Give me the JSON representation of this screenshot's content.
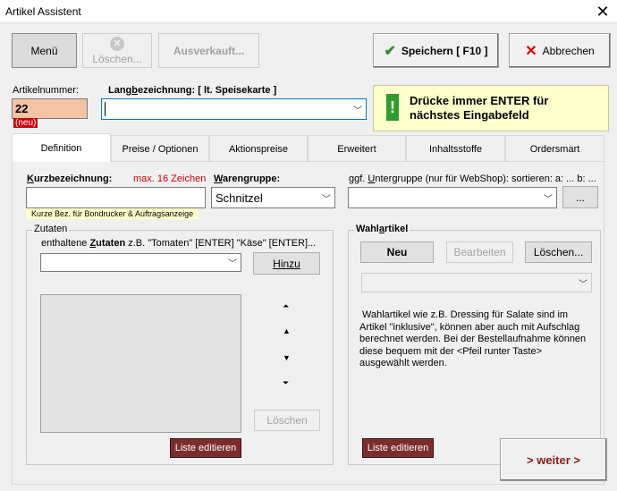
{
  "window": {
    "title": "Artikel Assistent",
    "close": "✕"
  },
  "toolbar": {
    "menu": "Menü",
    "delete": "Löschen...",
    "soldout": "Ausverkauft...",
    "save": "Speichern [ F10 ]",
    "cancel": "Abbrechen"
  },
  "header": {
    "artnr_label": "Artikelnummer:",
    "artnr_value": "22",
    "artnr_new": "(neu)",
    "lang_label_pre": "Lang",
    "lang_label_u": "b",
    "lang_label_post": "ezeichnung:  [ lt. Speisekarte ]",
    "lang_value": "",
    "info": "Drücke immer ENTER für nächstes Eingabefeld",
    "info_icon": "!"
  },
  "tabs": [
    "Definition",
    "Preise / Optionen",
    "Aktionspreise",
    "Erweitert",
    "Inhaltsstoffe",
    "Ordersmart"
  ],
  "definition": {
    "kurz_label_u": "K",
    "kurz_label_post": "urzbezeichnung:",
    "kurz_max": "max. 16 Zeichen",
    "kurz_value": "",
    "kurz_hint": "Kurze Bez. für Bondrucker & Auftragsanzeige",
    "warengruppe_label_u": "W",
    "warengruppe_label_post": "arengruppe:",
    "warengruppe_value": "Schnitzel",
    "untergruppe_label_pre": "ggf. ",
    "untergruppe_label_u": "U",
    "untergruppe_label_post": "ntergruppe (nur für WebShop): sortieren: a: ... b: ...",
    "untergruppe_value": "",
    "untergruppe_btn": "...",
    "zutaten": {
      "title": "Zutaten",
      "hint_pre": "enthaltene ",
      "hint_bold_u": "Z",
      "hint_bold": "utaten",
      "hint_post": " z.B. \"Tomaten\" [ENTER] \"Käse\" [ENTER]...",
      "add": "Hinzu",
      "delete": "Löschen",
      "edit_list": "Liste editieren"
    },
    "wahl": {
      "title_pre": "Wahl",
      "title_u": "a",
      "title_post": "rtikel",
      "new": "Neu",
      "edit": "Bearbeiten",
      "delete": "Löschen...",
      "desc": "Wahlartikel wie z.B. Dressing für Salate sind im Artikel \"inklusive\", können aber auch mit Aufschlag berechnet werden. Bei der Bestellaufnahme können diese bequem mit der <Pfeil runter Taste> ausgewählt werden.",
      "edit_list": "Liste editieren"
    },
    "next": "> weiter >"
  },
  "colors": {
    "artnr_bg": "#f4c3a3",
    "new_badge": "#d0000a",
    "info_bg": "#ffffcc",
    "info_icon_bg": "#2e9c2e",
    "red_btn": "#7b2c2c",
    "next_text": "#8b1a1a"
  }
}
